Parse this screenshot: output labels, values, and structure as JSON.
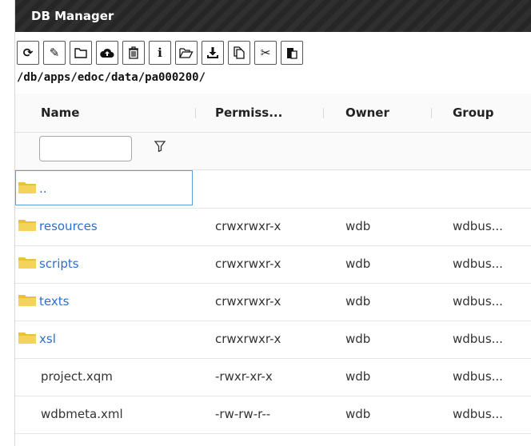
{
  "window": {
    "title": "DB Manager"
  },
  "toolbar": {
    "buttons": [
      {
        "name": "refresh-icon",
        "glyph": "⟳"
      },
      {
        "name": "edit-icon",
        "glyph": "✎"
      },
      {
        "name": "new-folder-icon",
        "glyph": "▭"
      },
      {
        "name": "upload-icon",
        "glyph": "☁"
      },
      {
        "name": "delete-icon",
        "glyph": "🗑"
      },
      {
        "name": "info-icon",
        "glyph": "i"
      },
      {
        "name": "open-folder-icon",
        "glyph": "▱"
      },
      {
        "name": "download-icon",
        "glyph": "⭳"
      },
      {
        "name": "copy-icon",
        "glyph": "⧉"
      },
      {
        "name": "cut-icon",
        "glyph": "✂"
      },
      {
        "name": "paste-icon",
        "glyph": "▣"
      }
    ]
  },
  "path": "/db/apps/edoc/data/pa000200/",
  "table": {
    "columns": [
      "Name",
      "Permiss...",
      "Owner",
      "Group"
    ],
    "filter": {
      "value": "",
      "placeholder": ""
    },
    "rows": [
      {
        "name": "..",
        "type": "folder",
        "perm": "",
        "owner": "",
        "group": ""
      },
      {
        "name": "resources",
        "type": "folder",
        "perm": "crwxrwxr-x",
        "owner": "wdb",
        "group": "wdbus..."
      },
      {
        "name": "scripts",
        "type": "folder",
        "perm": "crwxrwxr-x",
        "owner": "wdb",
        "group": "wdbus..."
      },
      {
        "name": "texts",
        "type": "folder",
        "perm": "crwxrwxr-x",
        "owner": "wdb",
        "group": "wdbus..."
      },
      {
        "name": "xsl",
        "type": "folder",
        "perm": "crwxrwxr-x",
        "owner": "wdb",
        "group": "wdbus..."
      },
      {
        "name": "project.xqm",
        "type": "file",
        "perm": "-rwxr-xr-x",
        "owner": "wdb",
        "group": "wdbus..."
      },
      {
        "name": "wdbmeta.xml",
        "type": "file",
        "perm": "-rw-rw-r--",
        "owner": "wdb",
        "group": "wdbus..."
      }
    ]
  },
  "colors": {
    "link": "#2a6fcf",
    "folder": "#e9c23b",
    "titlebar": "#2f2f2f",
    "selection": "#5aa0e0"
  }
}
